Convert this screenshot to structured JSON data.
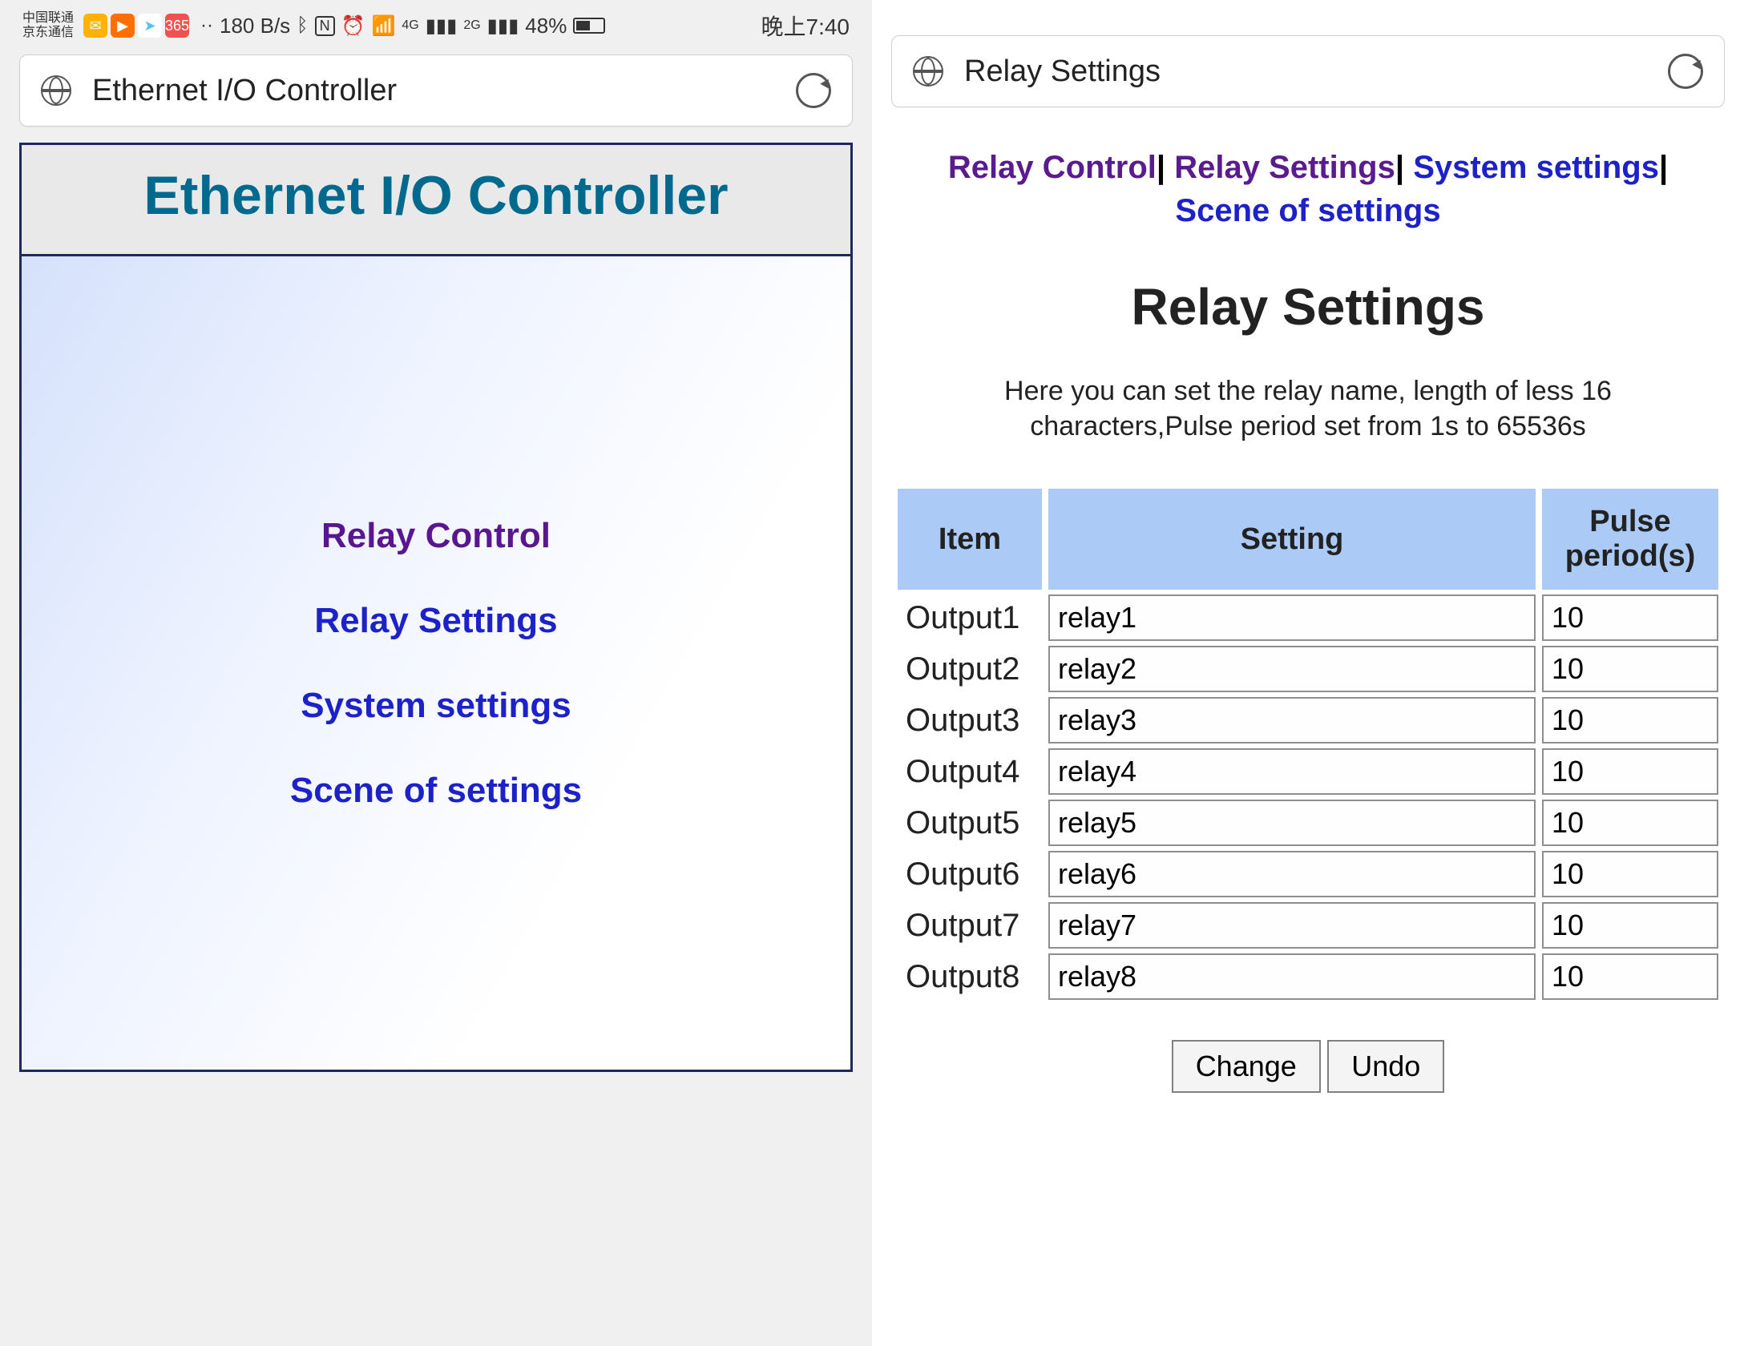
{
  "status": {
    "carrier1": "中国联通",
    "carrier2": "京东通信",
    "speed": "180 B/s",
    "sig1": "4G",
    "sig2": "2G",
    "battery": "48%",
    "time": "晚上7:40"
  },
  "left": {
    "address_title": "Ethernet I/O Controller",
    "header": "Ethernet I/O Controller",
    "links": {
      "relay_control": "Relay Control",
      "relay_settings": "Relay Settings",
      "system_settings": "System settings",
      "scene_settings": "Scene of settings"
    }
  },
  "right": {
    "address_title": "Relay Settings",
    "nav": {
      "relay_control": "Relay Control",
      "relay_settings": "Relay Settings",
      "system_settings": "System settings",
      "scene_settings": "Scene of settings",
      "sep": "|"
    },
    "heading": "Relay Settings",
    "note": "Here you can set the relay name, length of less 16 characters,Pulse period set from 1s to 65536s",
    "columns": {
      "item": "Item",
      "setting": "Setting",
      "pulse": "Pulse period(s)"
    },
    "rows": [
      {
        "item": "Output1",
        "setting": "relay1",
        "pulse": "10"
      },
      {
        "item": "Output2",
        "setting": "relay2",
        "pulse": "10"
      },
      {
        "item": "Output3",
        "setting": "relay3",
        "pulse": "10"
      },
      {
        "item": "Output4",
        "setting": "relay4",
        "pulse": "10"
      },
      {
        "item": "Output5",
        "setting": "relay5",
        "pulse": "10"
      },
      {
        "item": "Output6",
        "setting": "relay6",
        "pulse": "10"
      },
      {
        "item": "Output7",
        "setting": "relay7",
        "pulse": "10"
      },
      {
        "item": "Output8",
        "setting": "relay8",
        "pulse": "10"
      }
    ],
    "buttons": {
      "change": "Change",
      "undo": "Undo"
    }
  }
}
